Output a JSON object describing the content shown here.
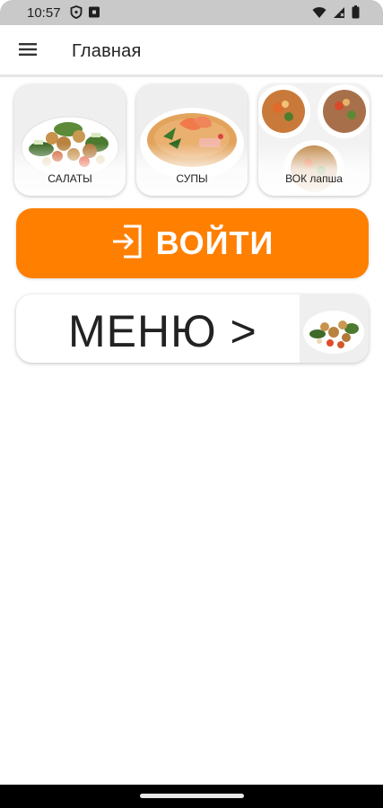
{
  "status_bar": {
    "time": "10:57",
    "left_icons": [
      "shield-icon",
      "notification-icon"
    ],
    "right_icons": [
      "wifi-icon",
      "signal-icon",
      "battery-icon"
    ]
  },
  "app_bar": {
    "menu_icon": "hamburger-menu-icon",
    "title": "Главная"
  },
  "categories": [
    {
      "label": "САЛАТЫ",
      "image": "salad-image"
    },
    {
      "label": "СУПЫ",
      "image": "soup-image"
    },
    {
      "label": "ВОК лапша",
      "image": "wok-noodles-image"
    }
  ],
  "login": {
    "label": "ВОЙТИ",
    "icon": "login-icon",
    "color": "#ff7f00"
  },
  "menu": {
    "label": "МЕНЮ >",
    "image": "salad-thumbnail-image"
  }
}
